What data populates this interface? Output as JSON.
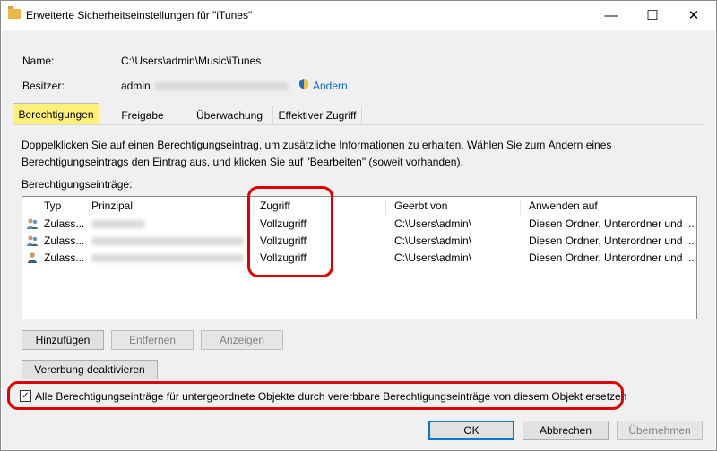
{
  "window": {
    "title": "Erweiterte Sicherheitseinstellungen für \"iTunes\"",
    "controls": {
      "minimize": "—",
      "maximize": "☐",
      "close": "✕"
    }
  },
  "info": {
    "name_label": "Name:",
    "name_value": "C:\\Users\\admin\\Music\\iTunes",
    "owner_label": "Besitzer:",
    "owner_value": "admin",
    "change_link": "Ändern"
  },
  "tabs": [
    {
      "label": "Berechtigungen",
      "active": true
    },
    {
      "label": "Freigabe"
    },
    {
      "label": "Überwachung"
    },
    {
      "label": "Effektiver Zugriff"
    }
  ],
  "description": "Doppelklicken Sie auf einen Berechtigungseintrag, um zusätzliche Informationen zu erhalten. Wählen Sie zum Ändern eines Berechtigungseintrags den Eintrag aus, und klicken Sie auf \"Bearbeiten\" (soweit vorhanden).",
  "entries_label": "Berechtigungseinträge:",
  "table": {
    "columns": [
      "Typ",
      "Prinzipal",
      "Zugriff",
      "Geerbt von",
      "Anwenden auf"
    ],
    "rows": [
      {
        "type": "Zulass...",
        "access": "Vollzugriff",
        "inherited": "C:\\Users\\admin\\",
        "applies": "Diesen Ordner, Unterordner und ..."
      },
      {
        "type": "Zulass...",
        "access": "Vollzugriff",
        "inherited": "C:\\Users\\admin\\",
        "applies": "Diesen Ordner, Unterordner und ..."
      },
      {
        "type": "Zulass...",
        "access": "Vollzugriff",
        "inherited": "C:\\Users\\admin\\",
        "applies": "Diesen Ordner, Unterordner und ..."
      }
    ]
  },
  "buttons": {
    "add": "Hinzufügen",
    "remove": "Entfernen",
    "view": "Anzeigen",
    "disable_inheritance": "Vererbung deaktivieren",
    "ok": "OK",
    "cancel": "Abbrechen",
    "apply": "Übernehmen"
  },
  "checkbox": {
    "label": "Alle Berechtigungseinträge für untergeordnete Objekte durch vererbbare Berechtigungseinträge von diesem Objekt ersetzen",
    "checked": true,
    "mark": "✓"
  },
  "colors": {
    "highlight": "#fff07a",
    "annotation": "#e00000",
    "link": "#0066cc"
  }
}
